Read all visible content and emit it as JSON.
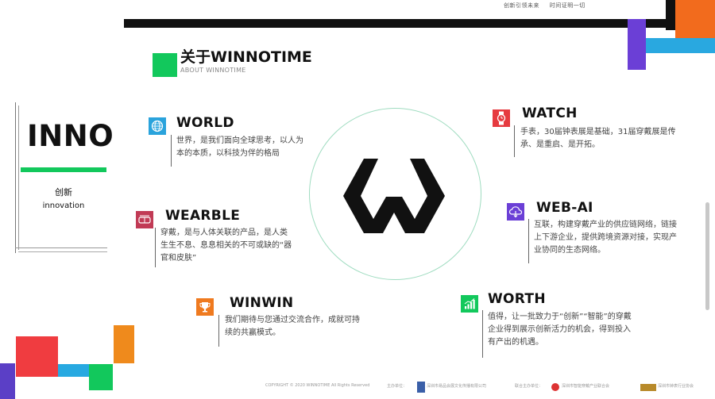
{
  "header_slogan": [
    "创新引领未来",
    "时间证明一切"
  ],
  "section": {
    "title": "关于WINNOTIME",
    "subtitle": "ABOUT WINNOTIME"
  },
  "inno_panel": {
    "title": "INNO",
    "cn_label": "创新",
    "en_label": "innovation"
  },
  "features": {
    "world": {
      "title": "WORLD",
      "icon": "globe-icon",
      "color": "#2aa3dc",
      "desc_lines": [
        "世界，是我们面向全球思考，以人为",
        "本的本质，以科技为伴的格局"
      ]
    },
    "wearble": {
      "title": "WEARBLE",
      "icon": "glasses-icon",
      "color": "#c13a55",
      "desc_lines": [
        "穿戴，是与人体关联的产品，是人类",
        "生生不息、息息相关的不可或缺的“器",
        "官和皮肤”"
      ]
    },
    "winwin": {
      "title": "WINWIN",
      "icon": "trophy-icon",
      "color": "#ef7a1f",
      "desc_lines": [
        "我们期待与您通过交流合作，成就可持",
        "续的共赢模式。"
      ]
    },
    "watch": {
      "title": "WATCH",
      "icon": "watch-icon",
      "color": "#e63a3f",
      "desc_lines": [
        "手表，30届钟表展是基础，31届穿戴展是传",
        "承、是重启、是开拓。"
      ]
    },
    "webai": {
      "title": "WEB-AI",
      "icon": "cloud-icon",
      "color": "#6b3fd6",
      "desc_lines": [
        "互联，构建穿戴产业的供应链网络，链接",
        "上下游企业，提供跨境资源对接，实现产",
        "业协同的生态网络。"
      ]
    },
    "worth": {
      "title": "WORTH",
      "icon": "bar-chart-icon",
      "color": "#12c85c",
      "desc_lines": [
        "值得，让一批致力于“创新”“智能”的穿戴",
        "企业得到展示创新活力的机会，得到投入",
        "有产出的机遇。"
      ]
    }
  },
  "footer": {
    "copyright": "COPYRIGHT © 2020 WINNOTIME All Rights Reserved",
    "host_label": "主办单位：",
    "host_org": "深圳市易品会展文化传播有限公司",
    "co_label": "联合主办单位：",
    "co_org1": "深圳市智能穿戴产业联合会",
    "co_org2": "深圳市钟表行业协会"
  }
}
